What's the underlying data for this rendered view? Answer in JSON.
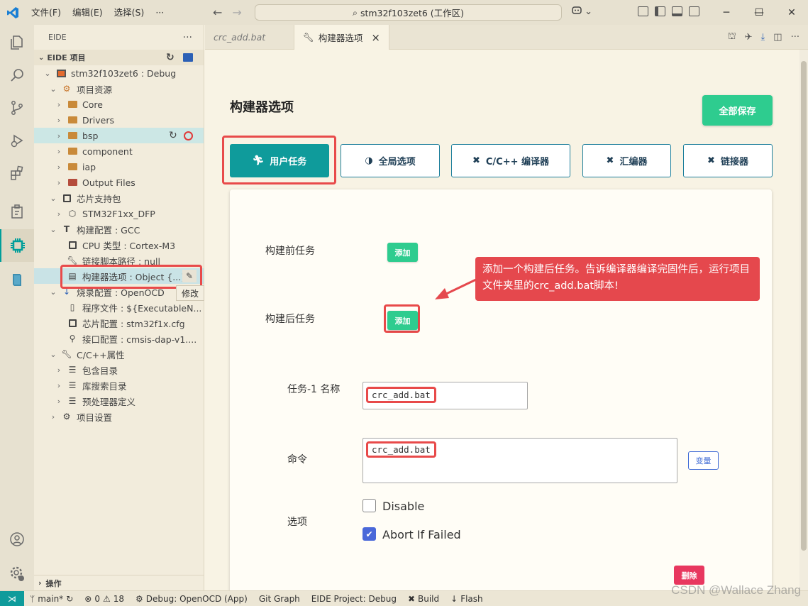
{
  "titlebar": {
    "menu": [
      "文件(F)",
      "编辑(E)",
      "选择(S)",
      "···"
    ],
    "search_text": "stm32f103zet6 (工作区)",
    "copilot_label": "⌄"
  },
  "sidebar": {
    "title": "EIDE",
    "more": "···",
    "section_title": "EIDE 项目",
    "project": "stm32f103zet6 : Debug",
    "items": [
      {
        "label": "项目资源"
      },
      {
        "label": "Core"
      },
      {
        "label": "Drivers"
      },
      {
        "label": "bsp"
      },
      {
        "label": "component"
      },
      {
        "label": "iap"
      },
      {
        "label": "Output Files"
      },
      {
        "label": "芯片支持包"
      },
      {
        "label": "STM32F1xx_DFP"
      },
      {
        "label": "构建配置 : GCC"
      },
      {
        "label": "CPU 类型 : Cortex-M3"
      },
      {
        "label": "链接脚本路径 : null"
      },
      {
        "label": "构建器选项 : Object {...}"
      },
      {
        "label": "烧录配置 : OpenOCD"
      },
      {
        "label": "程序文件 : ${ExecutableN..."
      },
      {
        "label": "芯片配置 : stm32f1x.cfg"
      },
      {
        "label": "接口配置 : cmsis-dap-v1...."
      },
      {
        "label": "C/C++属性"
      },
      {
        "label": "包含目录"
      },
      {
        "label": "库搜索目录"
      },
      {
        "label": "预处理器定义"
      },
      {
        "label": "项目设置"
      }
    ],
    "tooltip": "修改",
    "bottom_section": "操作"
  },
  "tabs": [
    {
      "label": "crc_add.bat"
    },
    {
      "label": "构建器选项",
      "close": "×"
    }
  ],
  "editor": {
    "page_title": "构建器选项",
    "save_all": "全部保存",
    "option_tabs": [
      "用户任务",
      "全局选项",
      "C/C++ 编译器",
      "汇编器",
      "链接器"
    ],
    "pre_task_label": "构建前任务",
    "post_task_label": "构建后任务",
    "add_label": "添加",
    "callout": "添加一个构建后任务。告诉编译器编译完固件后，运行项目文件夹里的crc_add.bat脚本!",
    "task_name_label": "任务-1 名称",
    "task_name_value": "crc_add.bat",
    "command_label": "命令",
    "command_value": "crc_add.bat",
    "variable_btn": "变量",
    "options_label": "选项",
    "disable_label": "Disable",
    "abort_label": "Abort If Failed",
    "abort_checked": true,
    "delete_label": "删除"
  },
  "statusbar": {
    "branch": "main*",
    "problems": "0",
    "warnings": "18",
    "debug": "Debug: OpenOCD (App)",
    "git_graph": "Git Graph",
    "eide_project": "EIDE Project: Debug",
    "build": "Build",
    "flash": "Flash"
  },
  "watermark": "CSDN @Wallace Zhang",
  "colors": {
    "accent": "#0f9b9b",
    "success": "#2ecc8f",
    "danger": "#e8375f",
    "callout": "#e5484d",
    "highlight_border": "#e84a4a"
  }
}
